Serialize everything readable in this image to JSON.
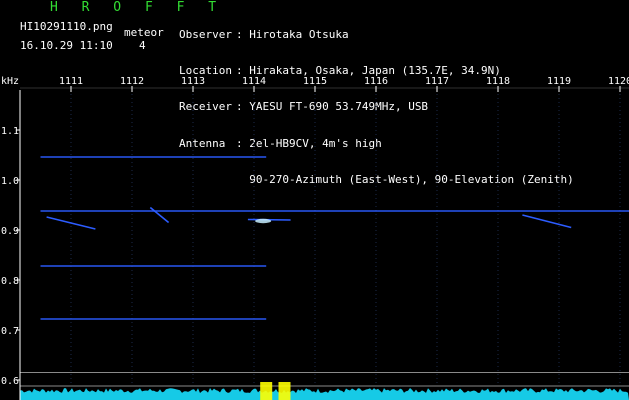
{
  "header": {
    "brand": "H R O F F T",
    "filename": "HI10291110.png",
    "datetime": "16.10.29 11:10",
    "meteor_label": "meteor",
    "meteor_count": "4"
  },
  "station": {
    "observer": {
      "key": "Observer",
      "sep": ":",
      "value": "Hirotaka Otsuka"
    },
    "location": {
      "key": "Location",
      "sep": ":",
      "value": "Hirakata, Osaka, Japan (135.7E, 34.9N)"
    },
    "receiver": {
      "key": "Receiver",
      "sep": ":",
      "value": "YAESU FT-690 53.749MHz, USB"
    },
    "antenna": {
      "key": "Antenna",
      "sep": ":",
      "value": "2el-HB9CV, 4m's high"
    },
    "antenna_2": "90-270-Azimuth (East-West), 90-Elevation (Zenith)"
  },
  "chart_data": {
    "type": "heatmap",
    "ylabel": "kHz",
    "x_ticks": [
      "1111",
      "1112",
      "1113",
      "1114",
      "1115",
      "1116",
      "1117",
      "1118",
      "1119",
      "1120"
    ],
    "y_ticks": [
      "1.1",
      "1.0",
      "0.9",
      "0.8",
      "0.7",
      "0.6"
    ],
    "ylim": [
      0.58,
      1.18
    ],
    "xlim": [
      1110.5,
      1120.2
    ],
    "colors": {
      "background": "#000000",
      "trace": "#2c5cff",
      "hot": "#c8f0ff",
      "noise": "#18e0ff",
      "burst": "#ffff00",
      "tick": "#ffffff"
    },
    "traces": [
      {
        "y": 1.046,
        "x_start": 1110.5,
        "x_end": 1114.2
      },
      {
        "y": 0.938,
        "x_start": 1110.5,
        "x_end": 1120.2
      },
      {
        "y": 0.828,
        "x_start": 1110.5,
        "x_end": 1114.2
      },
      {
        "y": 0.722,
        "x_start": 1110.5,
        "x_end": 1114.2
      }
    ],
    "meteor_streaks": [
      {
        "x_start": 1110.6,
        "y_start": 0.926,
        "x_end": 1111.4,
        "y_end": 0.902
      },
      {
        "x_start": 1112.3,
        "y_start": 0.945,
        "x_end": 1112.6,
        "y_end": 0.915
      },
      {
        "x_start": 1113.9,
        "y_start": 0.921,
        "x_end": 1114.6,
        "y_end": 0.92
      },
      {
        "x_start": 1118.4,
        "y_start": 0.93,
        "x_end": 1119.2,
        "y_end": 0.905
      }
    ],
    "reference_lines_khz": [
      0.615,
      0.588
    ],
    "noise_bursts_x": [
      1114.2,
      1114.5
    ]
  }
}
